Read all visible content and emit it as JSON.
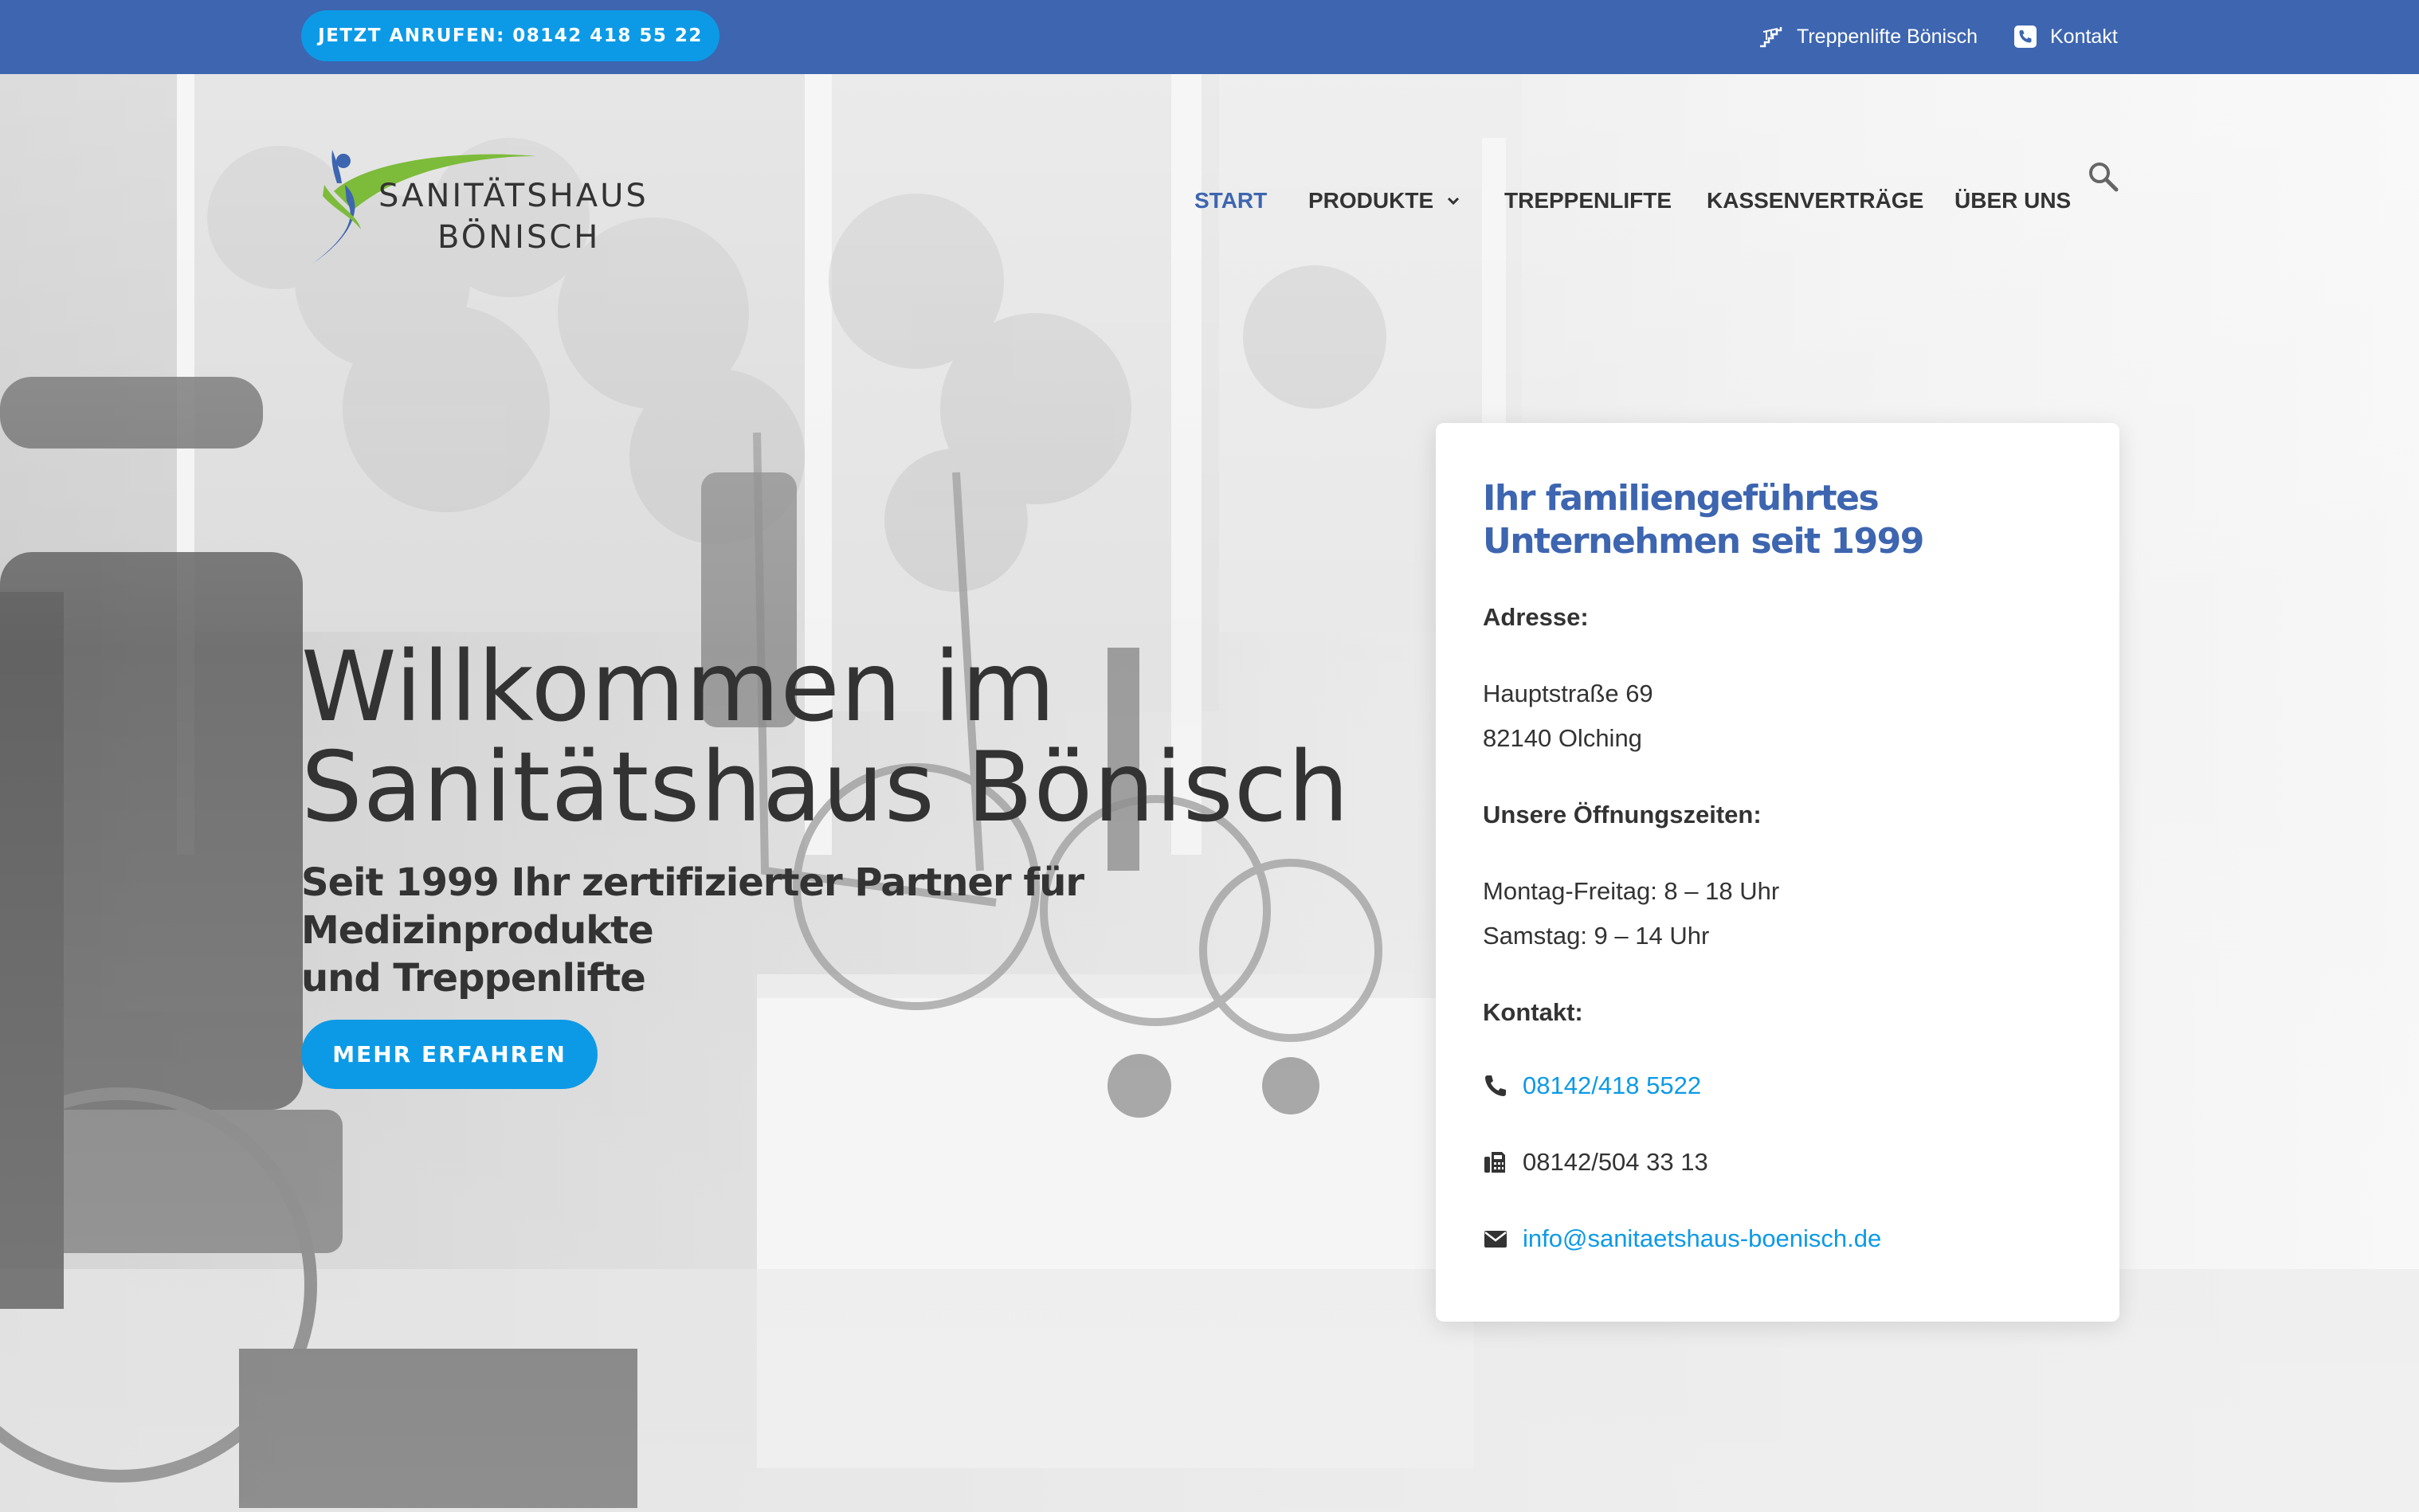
{
  "topbar": {
    "call_label": "JETZT ANRUFEN: 08142 418 55 22",
    "links": [
      {
        "label": "Treppenlifte Bönisch",
        "icon": "stairlift-icon"
      },
      {
        "label": "Kontakt",
        "icon": "phone-square-icon"
      }
    ]
  },
  "logo": {
    "line1": "SANITÄTSHAUS",
    "line2": "BÖNISCH"
  },
  "nav": {
    "items": [
      "START",
      "PRODUKTE",
      "TREPPENLIFTE",
      "KASSENVERTRÄGE",
      "ÜBER UNS"
    ],
    "active": "START"
  },
  "hero": {
    "title_line1": "Willkommen im",
    "title_line2": "Sanitätshaus Bönisch",
    "subtitle_line1": "Seit 1999 Ihr zertifizierter Partner für Medizinprodukte",
    "subtitle_line2": "und Treppenlifte",
    "button_label": "MEHR ERFAHREN"
  },
  "card": {
    "title_line1": "Ihr familiengeführtes",
    "title_line2": "Unternehmen seit 1999",
    "address_label": "Adresse:",
    "street": "Hauptstraße 69",
    "city": "82140 Olching",
    "hours_label": "Unsere Öffnungszeiten:",
    "hours_weekday": "Montag-Freitag: 8 – 18 Uhr",
    "hours_saturday": "Samstag: 9 – 14 Uhr",
    "contact_label": "Kontakt:",
    "phone": "08142/418 5522",
    "fax": "08142/504 33 13",
    "email": "info@sanitaetshaus-boenisch.de"
  },
  "colors": {
    "topbar": "#3d65b0",
    "accent_button": "#0c9ae6",
    "brand_blue": "#3d65b0",
    "text": "#333333"
  }
}
